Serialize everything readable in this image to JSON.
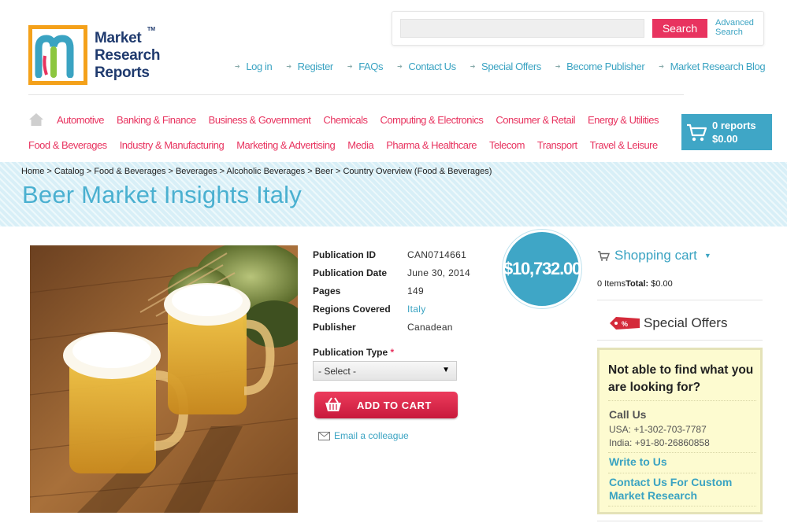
{
  "brand": {
    "logo_text": "Market Research Reports",
    "tm": "TM"
  },
  "search": {
    "value": "",
    "placeholder": "",
    "button_label": "Search",
    "advanced_line1": "Advanced",
    "advanced_line2": "Search"
  },
  "top_links": [
    "Log in",
    "Register",
    "FAQs",
    "Contact Us",
    "Special Offers",
    "Become Publisher",
    "Market Research Blog"
  ],
  "categories_row1": [
    "Automotive",
    "Banking & Finance",
    "Business & Government",
    "Chemicals",
    "Computing & Electronics",
    "Consumer & Retail",
    "Energy & Utilities"
  ],
  "categories_row2": [
    "Food & Beverages",
    "Industry & Manufacturing",
    "Marketing & Advertising",
    "Media",
    "Pharma & Healthcare",
    "Telecom",
    "Transport",
    "Travel & Leisure"
  ],
  "cart_summary": {
    "reports": "0 reports",
    "amount": "$0.00"
  },
  "breadcrumb": "Home > Catalog > Food & Beverages > Beverages > Alcoholic Beverages > Beer > Country Overview (Food & Beverages)",
  "page_title": "Beer Market Insights Italy",
  "details": {
    "publication_id_label": "Publication ID",
    "publication_id": "CAN0714661",
    "publication_date_label": "Publication Date",
    "publication_date": "June 30, 2014",
    "pages_label": "Pages",
    "pages": "149",
    "regions_label": "Regions Covered",
    "regions": "Italy",
    "publisher_label": "Publisher",
    "publisher": "Canadean"
  },
  "price": "$10,732.00",
  "publication_type": {
    "label": "Publication Type",
    "required_mark": "*",
    "selected": "- Select -"
  },
  "add_to_cart_label": "ADD TO CART",
  "email_colleague_label": "Email a colleague",
  "sidebar": {
    "shopping_cart_label": "Shopping cart",
    "items_text": "0 Items",
    "total_label": "Total:",
    "total_value": "$0.00",
    "special_offers_label": "Special Offers",
    "help_title": "Not able to find what you are looking for?",
    "call_us_label": "Call Us",
    "phone_usa": "USA: +1-302-703-7787",
    "phone_india": "India: +91-80-26860858",
    "write_to_us": "Write to Us",
    "custom_research": "Contact Us For Custom Market Research"
  },
  "colors": {
    "accent_pink": "#e8335f",
    "accent_blue": "#3fa6c6",
    "logo_orange": "#f4a11a",
    "logo_navy": "#1f3a6e"
  }
}
